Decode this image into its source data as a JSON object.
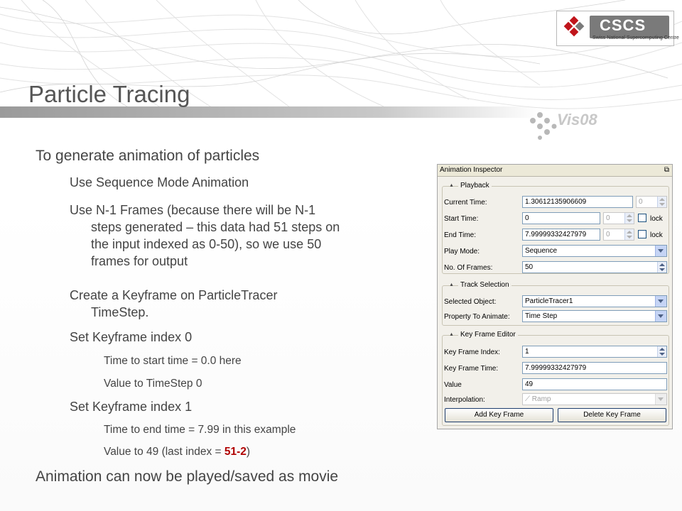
{
  "slide": {
    "title": "Particle Tracing",
    "logo_cscs": {
      "name": "CSCS",
      "subtitle": "Swiss National Supercomputing Centre"
    },
    "logo_vis": {
      "text": "Vis08"
    },
    "bullets": {
      "b1": "To generate animation of particles",
      "b1_1": "Use Sequence Mode Animation",
      "b1_2_lines": [
        "Use N-1 Frames (because there will be N-1",
        "steps generated – this data had 51 steps on",
        "the input indexed as 0-50), so we use 50",
        "frames for output"
      ],
      "b1_3_lines": [
        "Create a Keyframe on ParticleTracer",
        "TimeStep."
      ],
      "b1_4": "Set Keyframe index 0",
      "b1_4_1": "Time to start time = 0.0 here",
      "b1_4_2": "Value to TimeStep 0",
      "b1_5": "Set Keyframe index 1",
      "b1_5_1": "Time to end time = 7.99 in this example",
      "b1_5_2_pre": "Value to 49 (last index = ",
      "b1_5_2_red": "51-2",
      "b1_5_2_post": ")",
      "b2": "Animation can now be played/saved as movie"
    }
  },
  "inspector": {
    "title": "Animation Inspector",
    "playback": {
      "heading": "Playback",
      "current_time_label": "Current Time:",
      "current_time_value": "1.30612135906609",
      "current_time_index": "0",
      "start_time_label": "Start Time:",
      "start_time_value": "0",
      "start_time_index": "0",
      "start_lock_label": "lock",
      "end_time_label": "End Time:",
      "end_time_value": "7.99999332427979",
      "end_time_index": "0",
      "end_lock_label": "lock",
      "play_mode_label": "Play Mode:",
      "play_mode_value": "Sequence",
      "frames_label": "No. Of Frames:",
      "frames_value": "50"
    },
    "track": {
      "heading": "Track Selection",
      "object_label": "Selected Object:",
      "object_value": "ParticleTracer1",
      "property_label": "Property To Animate:",
      "property_value": "Time Step"
    },
    "keyframe": {
      "heading": "Key Frame Editor",
      "index_label": "Key Frame Index:",
      "index_value": "1",
      "time_label": "Key Frame Time:",
      "time_value": "7.99999332427979",
      "value_label": "Value",
      "value_value": "49",
      "interp_label": "Interpolation:",
      "interp_value": "Ramp",
      "add_button": "Add Key Frame",
      "delete_button": "Delete Key Frame"
    }
  },
  "colors": {
    "title": "#555555",
    "body_text": "#444444",
    "accent_red": "#b00000",
    "panel_bg": "#f2f0ea"
  }
}
